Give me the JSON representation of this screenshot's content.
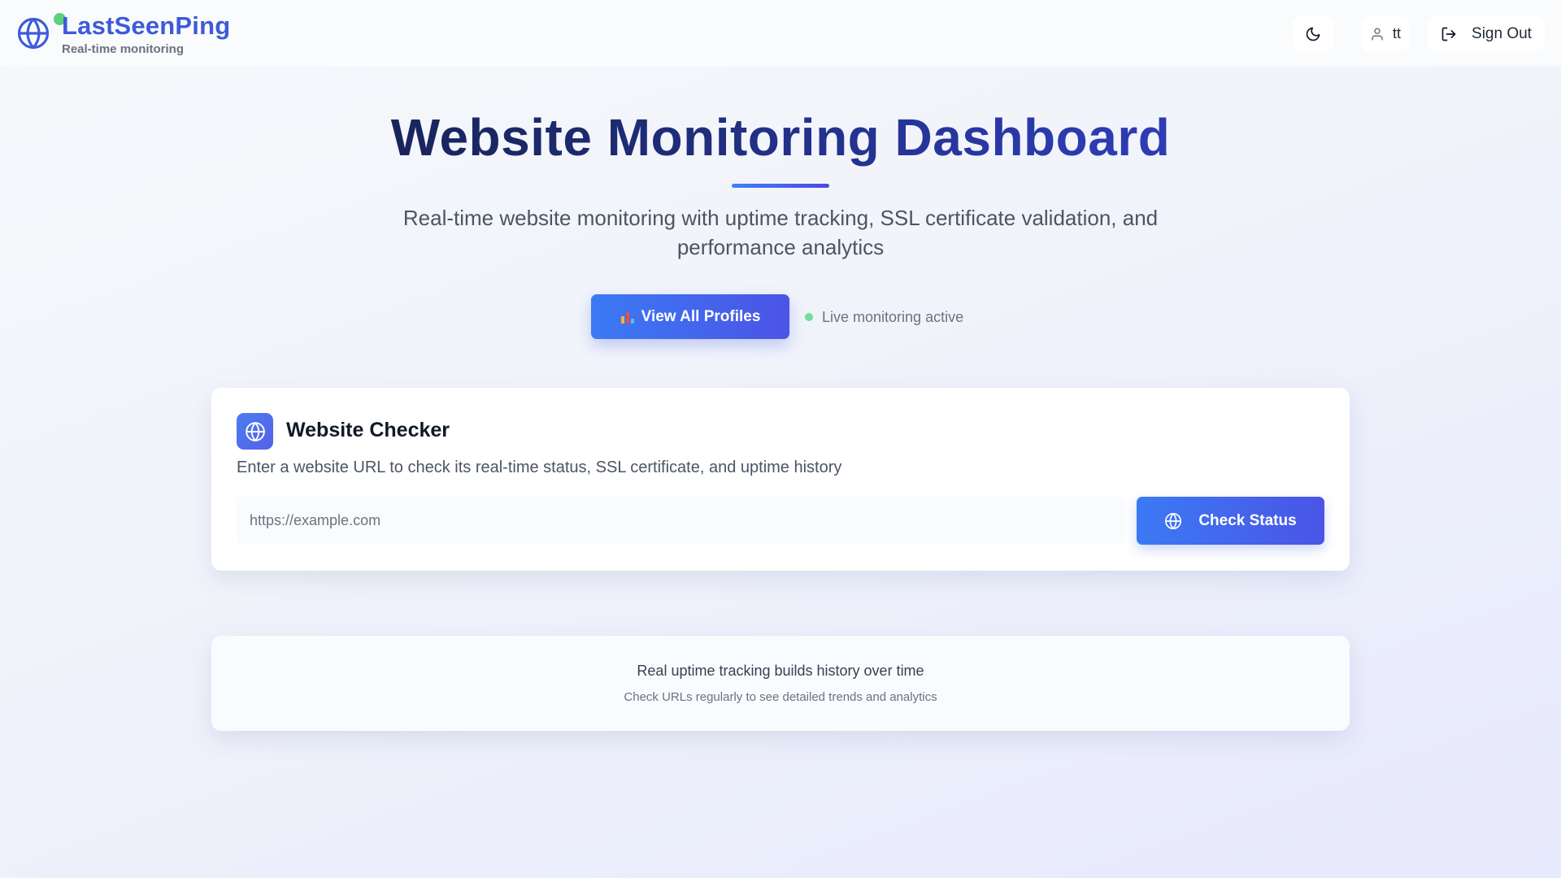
{
  "header": {
    "brand_name": "LastSeenPing",
    "brand_tagline": "Real-time monitoring",
    "logo_icon": "globe-icon",
    "theme_toggle_icon": "moon-icon",
    "user_icon": "user-icon",
    "user_label": "tt",
    "signout_icon": "logout-icon",
    "signout_label": "Sign Out"
  },
  "hero": {
    "title": "Website Monitoring Dashboard",
    "subtitle": "Real-time website monitoring with uptime tracking, SSL certificate validation, and performance analytics",
    "profiles_button_icon": "bar-chart-icon",
    "profiles_button_label": "View All Profiles",
    "live_status_label": "Live monitoring active"
  },
  "checker": {
    "icon": "globe-icon",
    "title": "Website Checker",
    "description": "Enter a website URL to check its real-time status, SSL certificate, and uptime history",
    "url_value": "",
    "url_placeholder": "https://example.com",
    "check_button_icon": "globe-icon",
    "check_button_label": "Check Status"
  },
  "info": {
    "title": "Real uptime tracking builds history over time",
    "subtitle": "Check URLs regularly to see detailed trends and analytics"
  },
  "colors": {
    "brand": "#3d5bd9",
    "accent_gradient_start": "#3b7af4",
    "accent_gradient_end": "#4b54e6",
    "live_dot": "#6ee09a",
    "brand_dot": "#5ad17a"
  }
}
